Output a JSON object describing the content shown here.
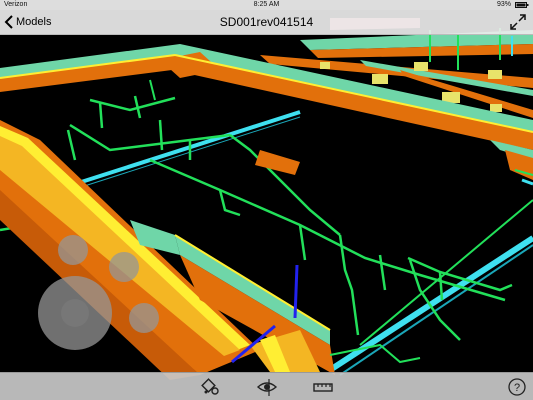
{
  "status_bar": {
    "carrier": "Verizon",
    "time": "8:25 AM",
    "battery": "93%"
  },
  "nav_bar": {
    "back_label": "Models",
    "title": "SD001rev041514",
    "back_icon": "chevron-left-icon",
    "expand_icon": "expand-arrows-icon"
  },
  "toolbar": {
    "items": [
      {
        "icon": "orbit-view-icon"
      },
      {
        "icon": "eye-visibility-icon"
      },
      {
        "icon": "section-box-icon"
      },
      {
        "icon": "help-icon"
      }
    ]
  },
  "model_colors": {
    "beam_orange": "#e2700b",
    "beam_teal": "#6fd6a8",
    "pipe_green": "#22e05a",
    "duct_cyan": "#3fe0f0",
    "edge_yellow": "#ffee33",
    "fixture_yellow": "#e8e36a",
    "riser_blue": "#2222ee"
  }
}
